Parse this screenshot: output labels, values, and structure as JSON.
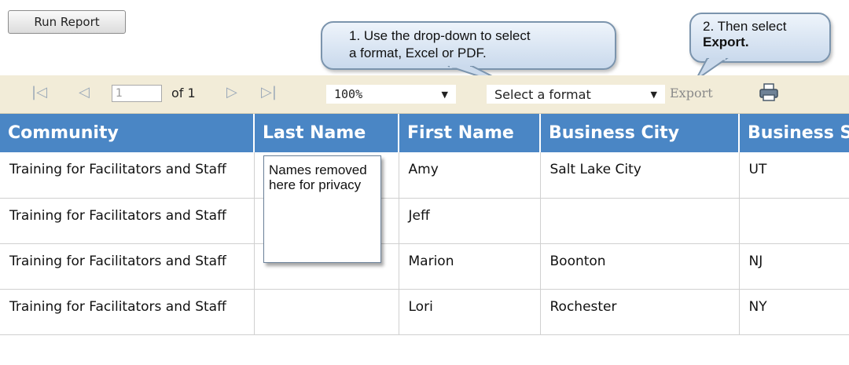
{
  "run_button": {
    "label": "Run Report"
  },
  "toolbar": {
    "page_value": "1",
    "of_label": "of 1",
    "zoom_value": "100%",
    "format_value": "Select a format",
    "export_label": "Export",
    "icons": [
      "first-page-icon",
      "previous-page-icon",
      "next-page-icon",
      "last-page-icon",
      "printer-icon"
    ]
  },
  "callouts": {
    "step1_line1": "1. Use the drop-down to select",
    "step1_line2": "a format, Excel or PDF.",
    "step2_line1": "2. Then select",
    "step2_bold": "Export."
  },
  "table": {
    "columns": [
      "Community",
      "Last Name",
      "First Name",
      "Business City",
      "Business State"
    ],
    "rows": [
      {
        "community": "Training for Facilitators and Staff",
        "last": "",
        "first": "Amy",
        "city": "Salt Lake City",
        "state": "UT"
      },
      {
        "community": "Training for Facilitators and Staff",
        "last": "",
        "first": "Jeff",
        "city": "",
        "state": ""
      },
      {
        "community": "Training for Facilitators and Staff",
        "last": "",
        "first": "Marion",
        "city": "Boonton",
        "state": "NJ"
      },
      {
        "community": "Training for Facilitators and Staff",
        "last": "",
        "first": "Lori",
        "city": "Rochester",
        "state": "NY"
      }
    ]
  },
  "note": {
    "text": "Names removed here for privacy"
  },
  "colors": {
    "header_bg": "#4a86c5",
    "toolbar_bg": "#f2ecd8",
    "callout_border": "#7b94ad"
  }
}
